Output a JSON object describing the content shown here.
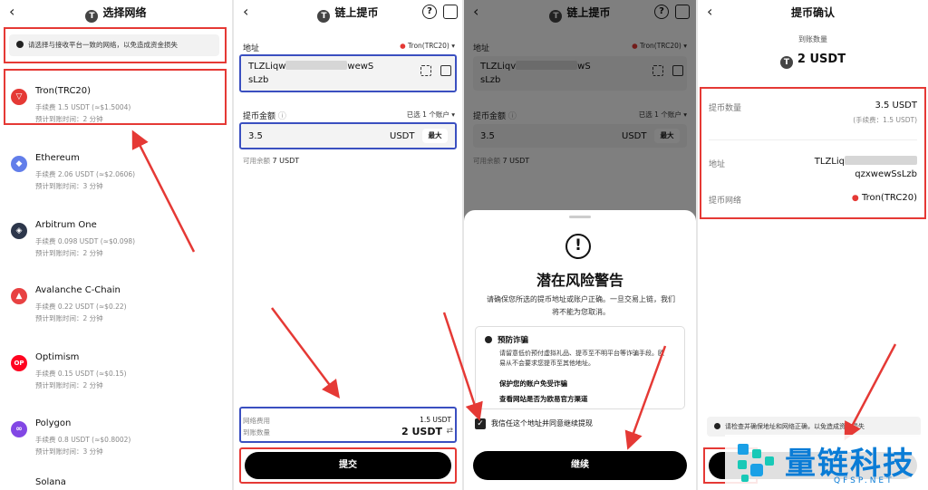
{
  "panel1": {
    "title": "选择网络",
    "notice": "请选择与接收平台一致的网络，以免造成资金损失",
    "networks": [
      {
        "name": "Tron(TRC20)",
        "fee": "手续费 1.5 USDT (≈$1.5004)",
        "eta": "预计到账时间：2 分钟",
        "color": "#e53935",
        "icon": "tron-icon"
      },
      {
        "name": "Ethereum",
        "fee": "手续费 2.06 USDT (≈$2.0606)",
        "eta": "预计到账时间：3 分钟",
        "color": "#627eea",
        "icon": "ethereum-icon"
      },
      {
        "name": "Arbitrum One",
        "fee": "手续费 0.098 USDT (≈$0.098)",
        "eta": "预计到账时间：2 分钟",
        "color": "#2d374b",
        "icon": "arbitrum-icon"
      },
      {
        "name": "Avalanche C-Chain",
        "fee": "手续费 0.22 USDT (≈$0.22)",
        "eta": "预计到账时间：2 分钟",
        "color": "#e84142",
        "icon": "avalanche-icon"
      },
      {
        "name": "Optimism",
        "fee": "手续费 0.15 USDT (≈$0.15)",
        "eta": "预计到账时间：2 分钟",
        "color": "#ff0420",
        "icon": "optimism-icon"
      },
      {
        "name": "Polygon",
        "fee": "手续费 0.8 USDT (≈$0.8002)",
        "eta": "预计到账时间：3 分钟",
        "color": "#8247e5",
        "icon": "polygon-icon"
      },
      {
        "name": "Solana",
        "fee": "",
        "eta": "",
        "color": "#111111",
        "icon": "solana-icon"
      }
    ]
  },
  "panel2": {
    "title": "链上提币",
    "address_label": "地址",
    "network_selected": "Tron(TRC20)",
    "address_part1": "TLZLiqw",
    "address_part1b": "wewS",
    "address_part2": "sLzb",
    "amount_label": "提币金额",
    "account_selector": "已选 1 个账户",
    "amount_value": "3.5",
    "currency": "USDT",
    "max_label": "最大",
    "available_label": "可用余额",
    "available_value": "7 USDT",
    "network_fee_label": "网络费用",
    "network_fee_value": "1.5 USDT",
    "receive_label": "到账数量",
    "receive_value": "2 USDT",
    "submit_label": "提交"
  },
  "panel3": {
    "title": "链上提币",
    "address_label": "地址",
    "network_selected": "Tron(TRC20)",
    "address_part1": "TLZLiqv",
    "address_part1b": "wS",
    "address_part2": "sLzb",
    "amount_label": "提币金额",
    "account_selector": "已选 1 个账户",
    "amount_value": "3.5",
    "currency": "USDT",
    "max_label": "最大",
    "available_label": "可用余额",
    "available_value": "7 USDT",
    "warning_title": "潜在风险警告",
    "warning_text_1": "请确保您所选的提币地址或账户正确。一旦交易上链，我们",
    "warning_text_2": "将不能为您取消。",
    "fraud_title": "预防诈骗",
    "fraud_text_1": "请留意低价预付虚拟礼品、提币至不明平台等诈骗手段。欧",
    "fraud_text_2": "易从不会要求您提币至其他地址。",
    "fraud_link_1": "保护您的账户免受诈骗",
    "fraud_link_2": "查看网站是否为欧易官方渠道",
    "checkbox_label": "我信任这个地址并同意继续提现",
    "continue_label": "继续"
  },
  "panel4": {
    "title": "提币确认",
    "receive_label": "到账数量",
    "receive_value": "2 USDT",
    "amount_label": "提币数量",
    "amount_value": "3.5 USDT",
    "fee_note": "(手续费：1.5 USDT)",
    "address_label": "地址",
    "address_part1": "TLZLiq",
    "address_part2": "qzxwewSsLzb",
    "network_label": "提币网络",
    "network_value": "Tron(TRC20)",
    "bottom_notice": "请检查并确保地址和网络正确，以免造成资金损失"
  },
  "watermark": {
    "text": "量链科技",
    "sub": "QFSP.NET"
  },
  "colors": {
    "highlight_red": "#e53935",
    "highlight_blue": "#3a4fc0",
    "button_black": "#000000"
  }
}
